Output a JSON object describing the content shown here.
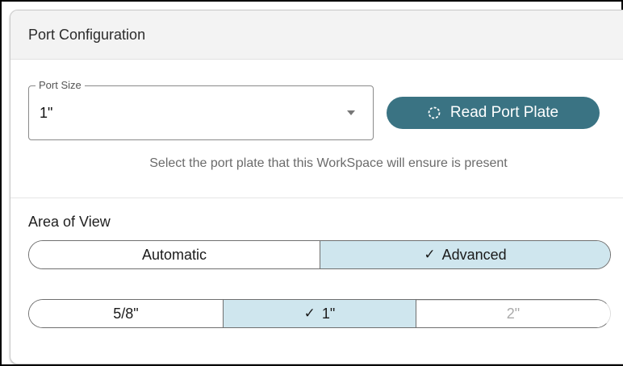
{
  "panel": {
    "title": "Port Configuration"
  },
  "port_size": {
    "label": "Port Size",
    "value": "1\""
  },
  "read_button": {
    "label": "Read Port Plate",
    "icon": "dashed-circle-icon"
  },
  "hint": "Select the port plate that this WorkSpace will ensure is present",
  "area_of_view": {
    "label": "Area of View",
    "options": [
      {
        "label": "Automatic",
        "selected": false
      },
      {
        "label": "Advanced",
        "selected": true
      }
    ]
  },
  "sizes": {
    "options": [
      {
        "label": "5/8\"",
        "selected": false,
        "disabled": false
      },
      {
        "label": "1\"",
        "selected": true,
        "disabled": false
      },
      {
        "label": "2\"",
        "selected": false,
        "disabled": true
      }
    ]
  },
  "colors": {
    "accent": "#3a7383",
    "selected_bg": "#cfe6ee"
  },
  "check_glyph": "✓"
}
